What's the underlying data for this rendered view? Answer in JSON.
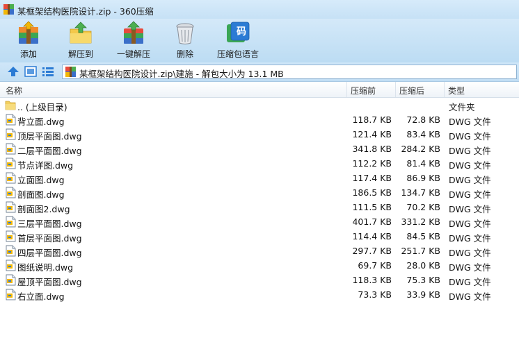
{
  "window": {
    "title": "某框架结构医院设计.zip - 360压缩"
  },
  "toolbar": {
    "buttons": [
      {
        "label": "添加",
        "icon": "add-archive-icon"
      },
      {
        "label": "解压到",
        "icon": "extract-to-icon"
      },
      {
        "label": "一键解压",
        "icon": "one-click-extract-icon"
      },
      {
        "label": "删除",
        "icon": "delete-trash-icon"
      },
      {
        "label": "压缩包语言",
        "icon": "archive-language-icon"
      }
    ],
    "language_icon_glyph": "码"
  },
  "addressbar": {
    "path": "某框架结构医院设计.zip\\建施 - 解包大小为 13.1 MB"
  },
  "columns": {
    "name": "名称",
    "size": "压缩前",
    "packed": "压缩后",
    "type": "类型"
  },
  "parent_row": {
    "name": ".. (上级目录)",
    "type": "文件夹"
  },
  "files": [
    {
      "name": "背立面.dwg",
      "size": "118.7 KB",
      "packed": "72.8 KB",
      "type": "DWG 文件"
    },
    {
      "name": "顶层平面图.dwg",
      "size": "121.4 KB",
      "packed": "83.4 KB",
      "type": "DWG 文件"
    },
    {
      "name": "二层平面图.dwg",
      "size": "341.8 KB",
      "packed": "284.2 KB",
      "type": "DWG 文件"
    },
    {
      "name": "节点详图.dwg",
      "size": "112.2 KB",
      "packed": "81.4 KB",
      "type": "DWG 文件"
    },
    {
      "name": "立面图.dwg",
      "size": "117.4 KB",
      "packed": "86.9 KB",
      "type": "DWG 文件"
    },
    {
      "name": "剖面图.dwg",
      "size": "186.5 KB",
      "packed": "134.7 KB",
      "type": "DWG 文件"
    },
    {
      "name": "剖面图2.dwg",
      "size": "111.5 KB",
      "packed": "70.2 KB",
      "type": "DWG 文件"
    },
    {
      "name": "三层平面图.dwg",
      "size": "401.7 KB",
      "packed": "331.2 KB",
      "type": "DWG 文件"
    },
    {
      "name": "首层平面图.dwg",
      "size": "114.4 KB",
      "packed": "84.5 KB",
      "type": "DWG 文件"
    },
    {
      "name": "四层平面图.dwg",
      "size": "297.7 KB",
      "packed": "251.7 KB",
      "type": "DWG 文件"
    },
    {
      "name": "图纸说明.dwg",
      "size": "69.7 KB",
      "packed": "28.0 KB",
      "type": "DWG 文件"
    },
    {
      "name": "屋顶平面图.dwg",
      "size": "118.3 KB",
      "packed": "75.3 KB",
      "type": "DWG 文件"
    },
    {
      "name": "右立面.dwg",
      "size": "73.3 KB",
      "packed": "33.9 KB",
      "type": "DWG 文件"
    }
  ],
  "colors": {
    "toolbar_bg": "#c9e3f6",
    "accent_blue": "#2b7bd4",
    "folder_yellow": "#f3cf5d"
  }
}
